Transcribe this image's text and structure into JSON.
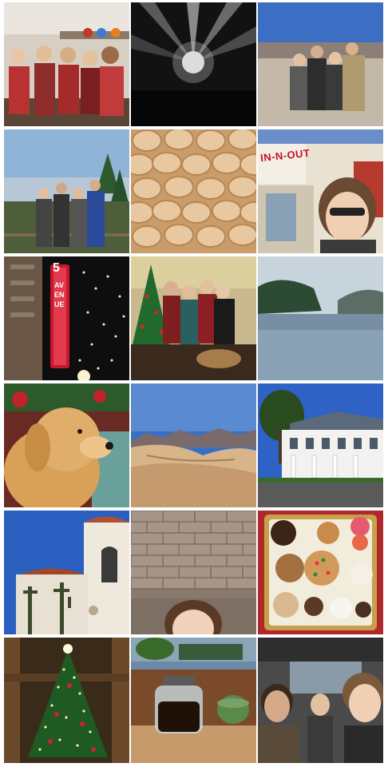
{
  "grid": {
    "signs": {
      "in_n_out": "IN-N-OUT",
      "fifth_avenue_number": "5",
      "fifth_avenue_name": "AVENUE"
    }
  }
}
